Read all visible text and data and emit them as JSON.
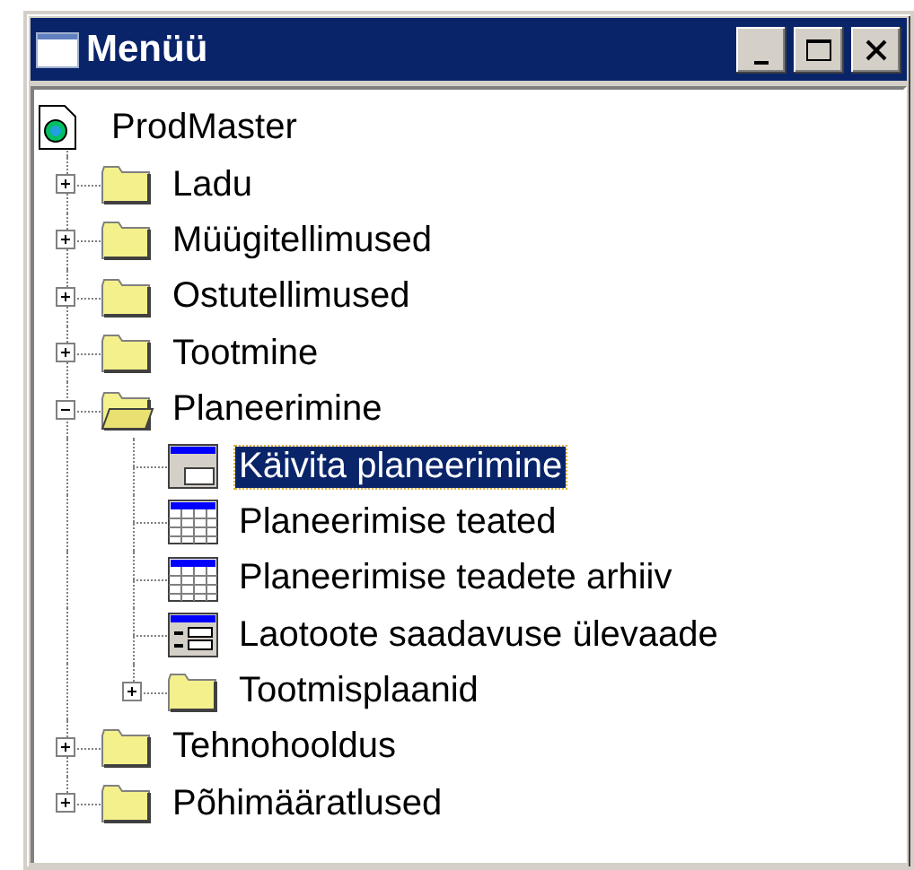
{
  "window": {
    "title": "Menüü"
  },
  "tree": {
    "label": "ProdMaster",
    "kind": "root",
    "children": [
      {
        "label": "Ladu",
        "kind": "folder",
        "expanded": false,
        "selected": false
      },
      {
        "label": "Müügitellimused",
        "kind": "folder",
        "expanded": false,
        "selected": false
      },
      {
        "label": "Ostutellimused",
        "kind": "folder",
        "expanded": false,
        "selected": false
      },
      {
        "label": "Tootmine",
        "kind": "folder",
        "expanded": false,
        "selected": false
      },
      {
        "label": "Planeerimine",
        "kind": "folder",
        "expanded": true,
        "selected": false,
        "children": [
          {
            "label": "Käivita planeerimine",
            "kind": "form",
            "selected": true
          },
          {
            "label": "Planeerimise teated",
            "kind": "grid",
            "selected": false
          },
          {
            "label": "Planeerimise teadete arhiiv",
            "kind": "grid",
            "selected": false
          },
          {
            "label": "Laotoote saadavuse ülevaade",
            "kind": "list",
            "selected": false
          },
          {
            "label": "Tootmisplaanid",
            "kind": "folder",
            "expanded": false,
            "selected": false
          }
        ]
      },
      {
        "label": "Tehnohooldus",
        "kind": "folder",
        "expanded": false,
        "selected": false
      },
      {
        "label": "Põhimääratlused",
        "kind": "folder",
        "expanded": false,
        "selected": false
      }
    ]
  }
}
